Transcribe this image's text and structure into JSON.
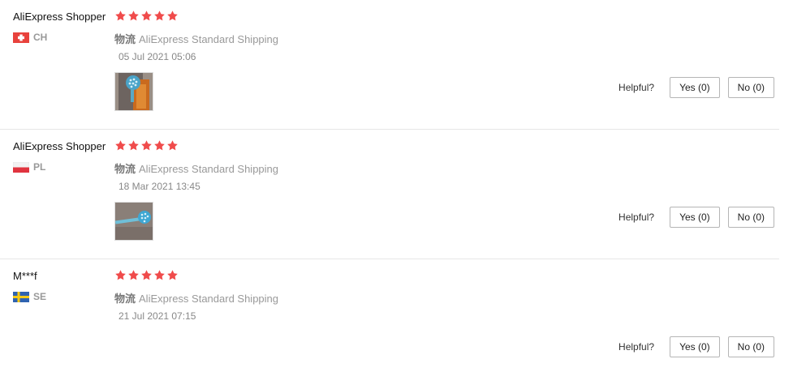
{
  "reviews": [
    {
      "user": "AliExpress Shopper",
      "country": "CH",
      "flag": "ch",
      "stars": 5,
      "shipping_label": "物流",
      "shipping_value": "AliExpress Standard Shipping",
      "date": "05 Jul 2021 05:06",
      "helpful_label": "Helpful?",
      "yes_label": "Yes (0)",
      "no_label": "No (0)"
    },
    {
      "user": "AliExpress Shopper",
      "country": "PL",
      "flag": "pl",
      "stars": 5,
      "shipping_label": "物流",
      "shipping_value": "AliExpress Standard Shipping",
      "date": "18 Mar 2021 13:45",
      "helpful_label": "Helpful?",
      "yes_label": "Yes (0)",
      "no_label": "No (0)"
    },
    {
      "user": "M***f",
      "country": "SE",
      "flag": "se",
      "stars": 5,
      "shipping_label": "物流",
      "shipping_value": "AliExpress Standard Shipping",
      "date": "21 Jul 2021 07:15",
      "helpful_label": "Helpful?",
      "yes_label": "Yes (0)",
      "no_label": "No (0)"
    }
  ],
  "colors": {
    "star": "#f04b4b",
    "divider": "#e6e6e6"
  }
}
